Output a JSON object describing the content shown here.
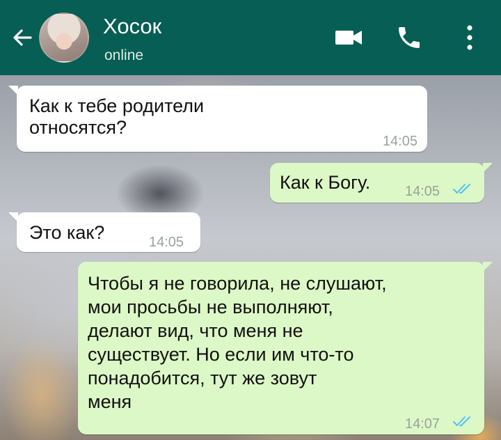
{
  "header": {
    "contact_name": "Хосок",
    "status": "online"
  },
  "colors": {
    "header": "#075e54",
    "incoming_bubble": "#ffffff",
    "outgoing_bubble": "#dcf8c6",
    "read_ticks": "#4fc3f7",
    "timestamp": "#9aa29c"
  },
  "icons": {
    "back": "arrow-left-icon",
    "avatar": "contact-avatar",
    "video": "video-camera-icon",
    "call": "phone-icon",
    "more": "more-vertical-icon",
    "read_receipt": "double-check-icon"
  },
  "messages": [
    {
      "direction": "in",
      "lines": [
        "Как к тебе родители",
        "относятся?"
      ],
      "time": "14:05"
    },
    {
      "direction": "out",
      "lines": [
        "Как к Богу."
      ],
      "time": "14:05",
      "read": true
    },
    {
      "direction": "in",
      "lines": [
        "Это как?"
      ],
      "time": "14:05"
    },
    {
      "direction": "out",
      "lines": [
        "Чтобы я не говорила, не слушают,",
        "мои просьбы не выполняют,",
        "делают вид, что меня не",
        "существует. Но если им что-то",
        "понадобится, тут же зовут",
        "меня"
      ],
      "time": "14:07",
      "read": true
    }
  ]
}
